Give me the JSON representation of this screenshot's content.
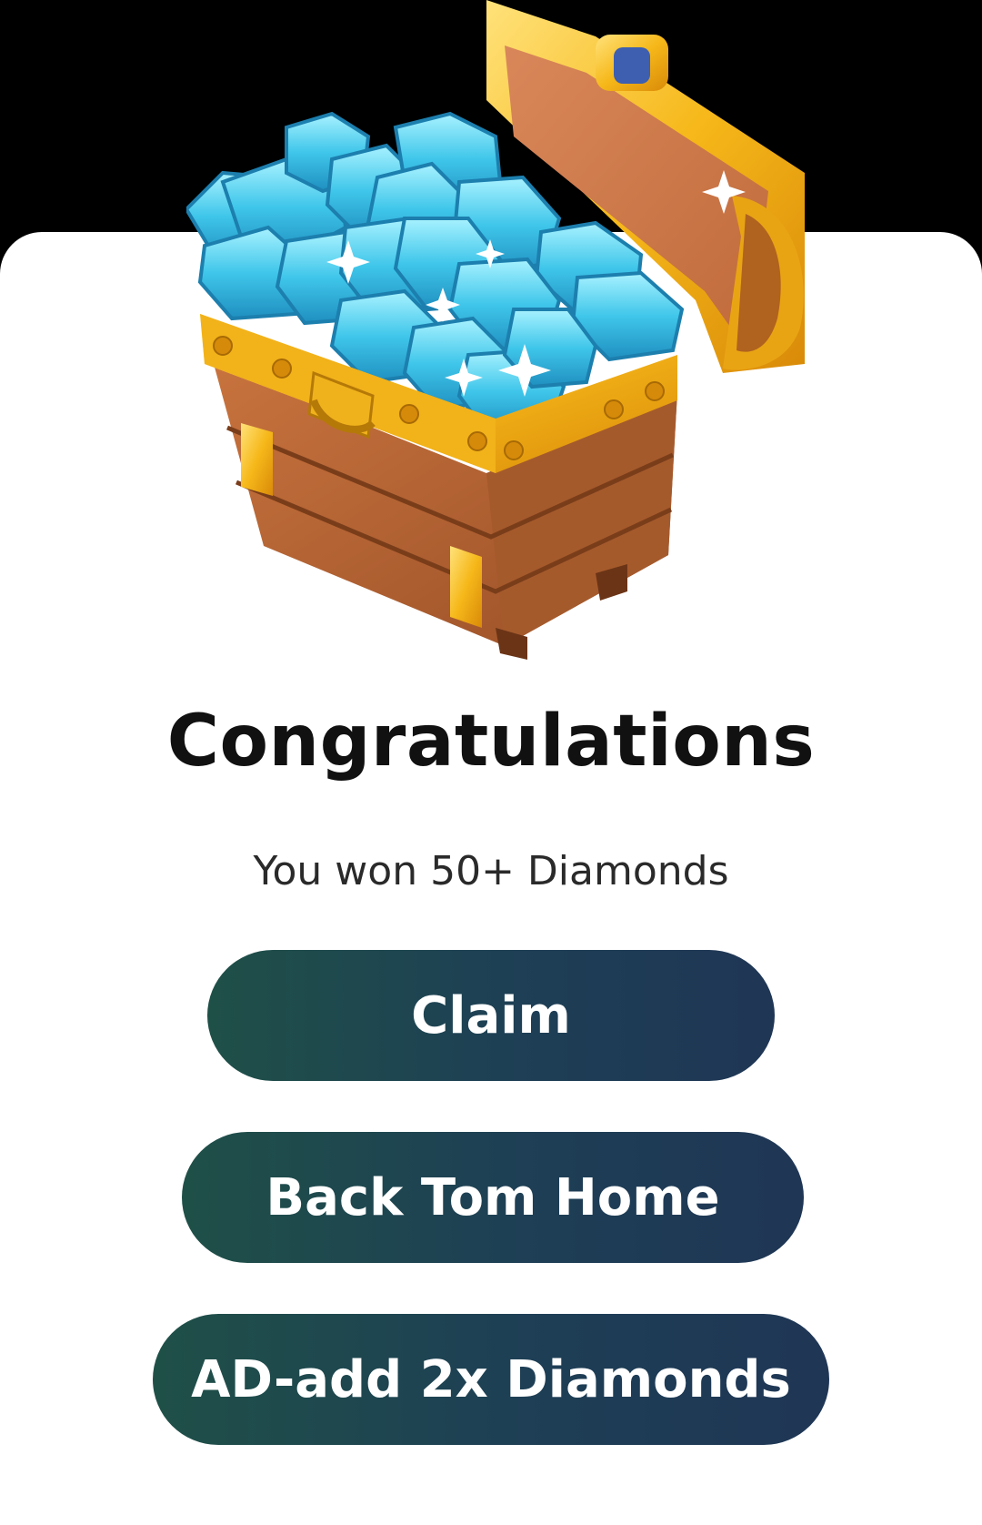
{
  "dialog": {
    "title": "Congratulations",
    "subtitle": "You won 50+ Diamonds"
  },
  "buttons": {
    "claim_label": "Claim",
    "back_home_label": "Back Tom Home",
    "ad_double_label": "AD-add 2x Diamonds"
  },
  "colors": {
    "button_gradient_start": "#1f5048",
    "button_gradient_end": "#1f3655",
    "card_background": "#ffffff",
    "screen_background": "#000000"
  },
  "illustration": {
    "icon": "treasure-chest-diamonds-icon"
  }
}
